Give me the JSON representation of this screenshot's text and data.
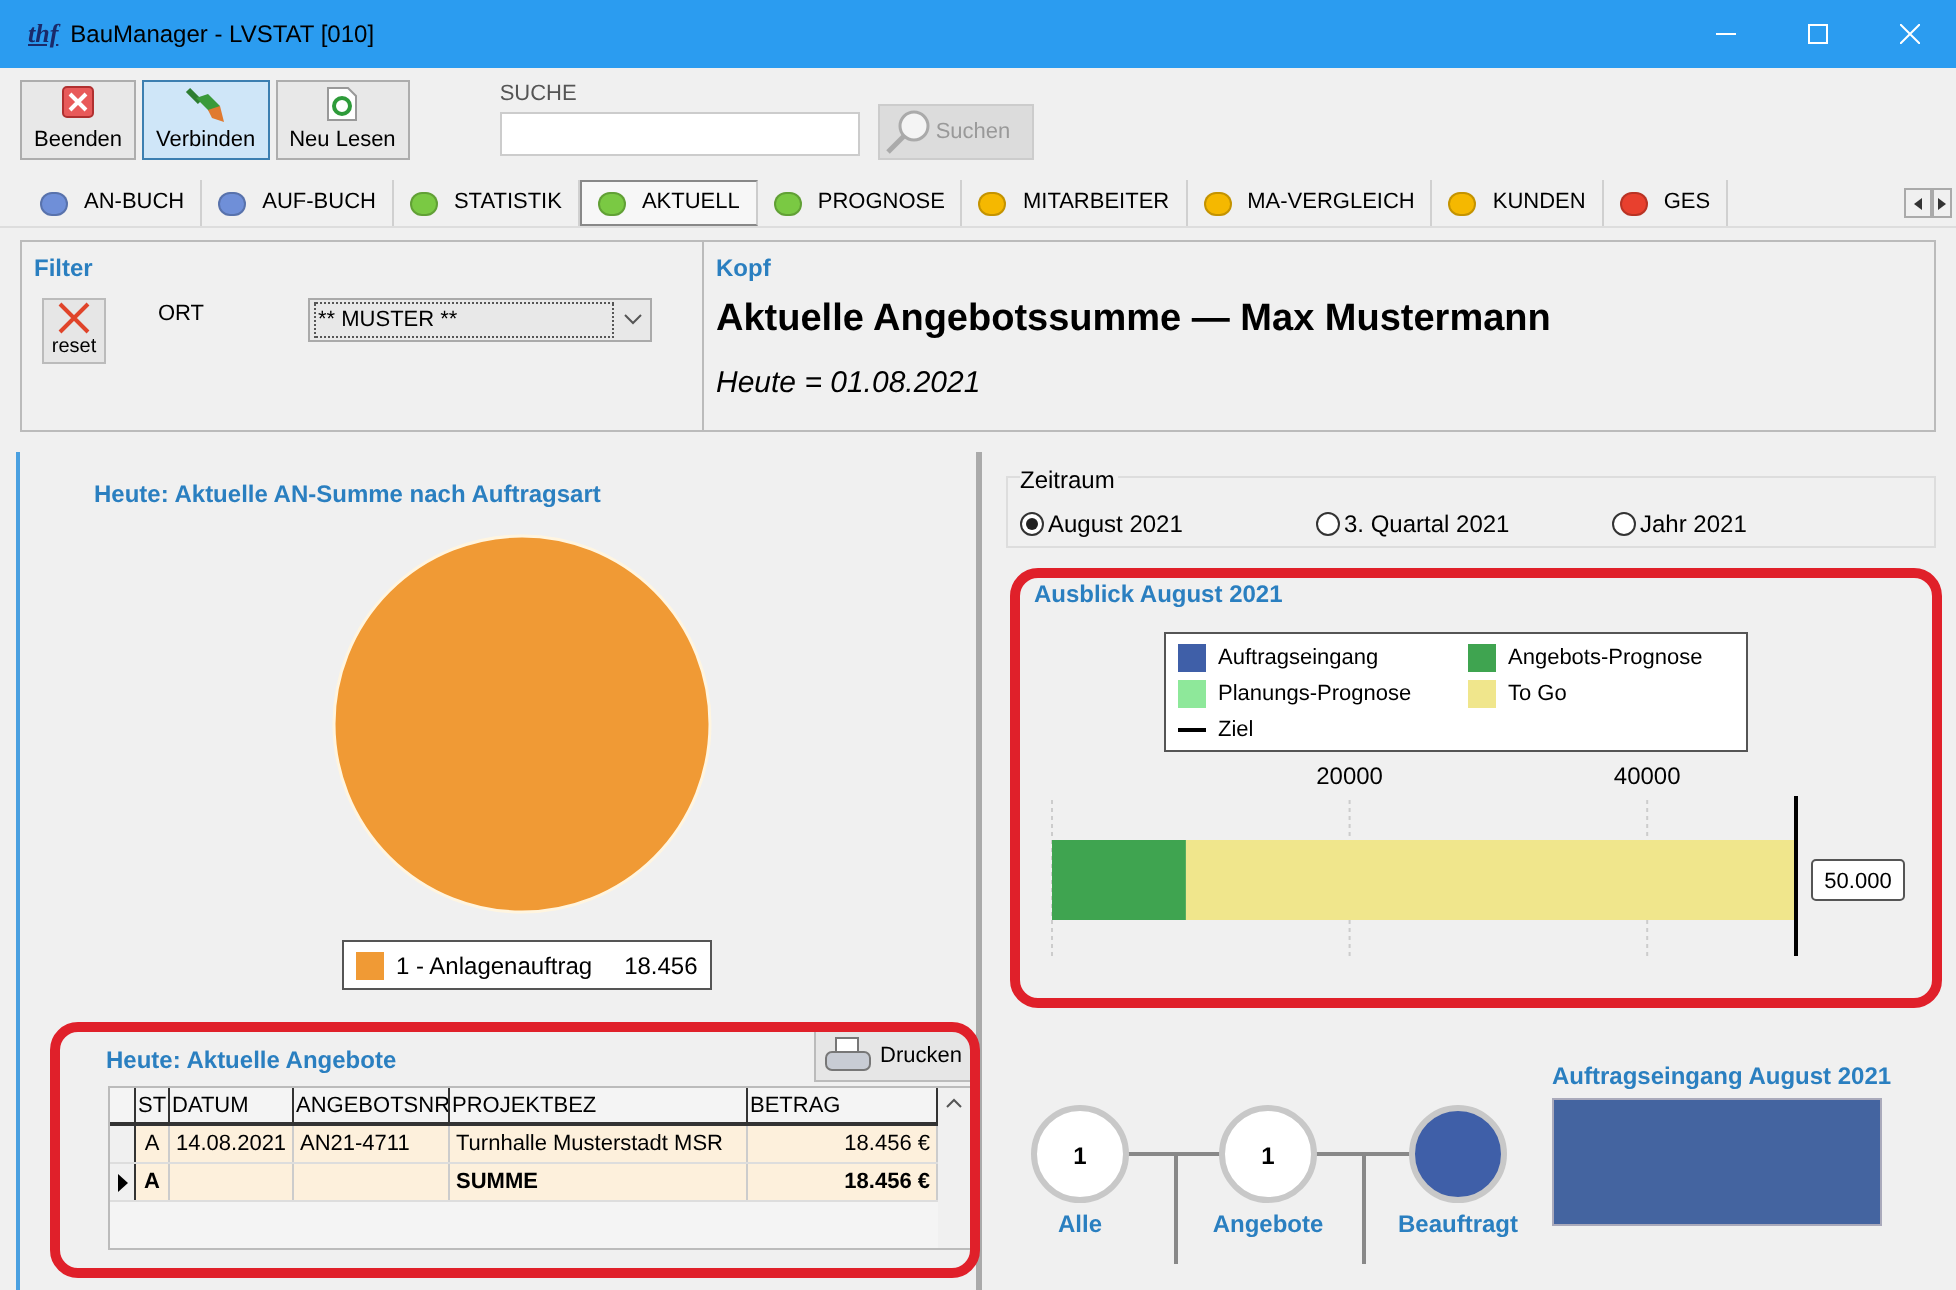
{
  "window": {
    "title": "BauManager - LVSTAT [010]",
    "logo": "thf"
  },
  "toolbar": {
    "buttons": [
      {
        "label": "Beenden",
        "kind": "close",
        "selected": false
      },
      {
        "label": "Verbinden",
        "kind": "plug",
        "selected": true
      },
      {
        "label": "Neu Lesen",
        "kind": "refresh",
        "selected": false
      }
    ],
    "search": {
      "label": "SUCHE",
      "button": "Suchen",
      "disabled": true
    }
  },
  "tabs": [
    {
      "label": "AN-BUCH",
      "color": "#6f8fd8",
      "selected": false
    },
    {
      "label": "AUF-BUCH",
      "color": "#6f8fd8",
      "selected": false
    },
    {
      "label": "STATISTIK",
      "color": "#7ac943",
      "selected": false
    },
    {
      "label": "AKTUELL",
      "color": "#7ac943",
      "selected": true
    },
    {
      "label": "PROGNOSE",
      "color": "#7ac943",
      "selected": false
    },
    {
      "label": "MITARBEITER",
      "color": "#f5b800",
      "selected": false
    },
    {
      "label": "MA-VERGLEICH",
      "color": "#f5b800",
      "selected": false
    },
    {
      "label": "KUNDEN",
      "color": "#f5b800",
      "selected": false
    },
    {
      "label": "GES",
      "color": "#e8402e",
      "selected": false
    }
  ],
  "filter": {
    "title": "Filter",
    "reset": "reset",
    "field_label": "ORT",
    "dropdown_value": "** MUSTER **"
  },
  "kopf": {
    "title": "Kopf",
    "heading": "Aktuelle Angebotssumme — Max Mustermann",
    "date": "Heute = 01.08.2021"
  },
  "pie_panel": {
    "title": "Heute: Aktuelle AN-Summe nach Auftragsart",
    "legend": [
      {
        "value": "18.456",
        "color": "#f09a35"
      }
    ],
    "chart_data": {
      "type": "pie",
      "categories": [
        "1 - Anlagenauftrag"
      ],
      "values": [
        100
      ]
    }
  },
  "offers": {
    "highlighted": true,
    "title": "Heute: Aktuelle Angebote",
    "print_button": "Drucken",
    "columns": [
      "ST",
      "DATUM",
      "ANGEBOTSNR",
      "PROJEKTBEZ",
      "BETRAG"
    ],
    "rows": [
      {
        "kind": "data",
        "selected": false,
        "cells": [
          "A",
          "14.08.2021",
          "AN21-4711",
          "Turnhalle Musterstadt MSR",
          "18.456 €"
        ]
      },
      {
        "kind": "sum",
        "selected": true,
        "cells": [
          "A",
          "",
          "",
          "SUMME",
          "18.456 €"
        ]
      }
    ]
  },
  "zeitraum": {
    "label": "Zeitraum",
    "options": [
      {
        "label": "August 2021",
        "selected": true
      },
      {
        "label": "3. Quartal 2021",
        "selected": false
      },
      {
        "label": "Jahr 2021",
        "selected": false
      }
    ]
  },
  "outlook": {
    "highlighted": true,
    "title": "Ausblick August 2021",
    "target_legend": "Ziel",
    "target_label": "50.000",
    "chart_data": {
      "type": "bar",
      "orientation": "horizontal",
      "stacked": true,
      "series": [
        {
          "name": "Auftragseingang",
          "color": "#3f5fa8",
          "values": [
            0
          ]
        },
        {
          "name": "Angebots-Prognose",
          "color": "#3fa450",
          "values": [
            9000
          ]
        },
        {
          "name": "Planungs-Prognose",
          "color": "#8ee89a",
          "values": [
            0
          ]
        },
        {
          "name": "To Go",
          "color": "#f0e68c",
          "values": [
            41000
          ]
        }
      ],
      "xlim": [
        0,
        50000
      ],
      "xticks": [
        20000,
        40000
      ]
    }
  },
  "flow": {
    "nodes": [
      {
        "label": "Alle",
        "count": "1",
        "filled": false
      },
      {
        "label": "Angebote",
        "count": "1",
        "filled": false
      },
      {
        "label": "Beauftragt",
        "filled": true
      }
    ]
  },
  "incoming": {
    "title": "Auftragseingang August 2021"
  }
}
